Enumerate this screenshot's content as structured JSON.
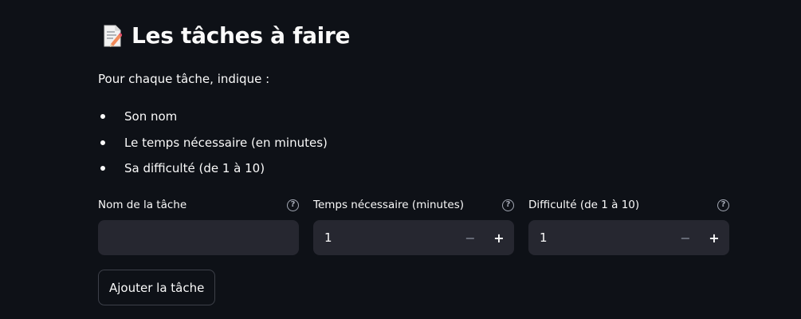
{
  "header": {
    "icon": "memo-icon",
    "title": "Les tâches à faire"
  },
  "intro": "Pour chaque tâche, indique :",
  "bullets": [
    "Son nom",
    "Le temps nécessaire (en minutes)",
    "Sa difficulté (de 1 à 10)"
  ],
  "form": {
    "name_field": {
      "label": "Nom de la tâche",
      "value": "",
      "help_icon": "question-circle-icon"
    },
    "time_field": {
      "label": "Temps nécessaire (minutes)",
      "value": "1",
      "decrement": "−",
      "increment": "+",
      "help_icon": "question-circle-icon"
    },
    "difficulty_field": {
      "label": "Difficulté (de 1 à 10)",
      "value": "1",
      "decrement": "−",
      "increment": "+",
      "help_icon": "question-circle-icon"
    },
    "submit_label": "Ajouter la tâche"
  },
  "colors": {
    "background": "#0e1117",
    "input_background": "#262730",
    "text": "#fafafa",
    "muted": "#a3a8b4"
  }
}
